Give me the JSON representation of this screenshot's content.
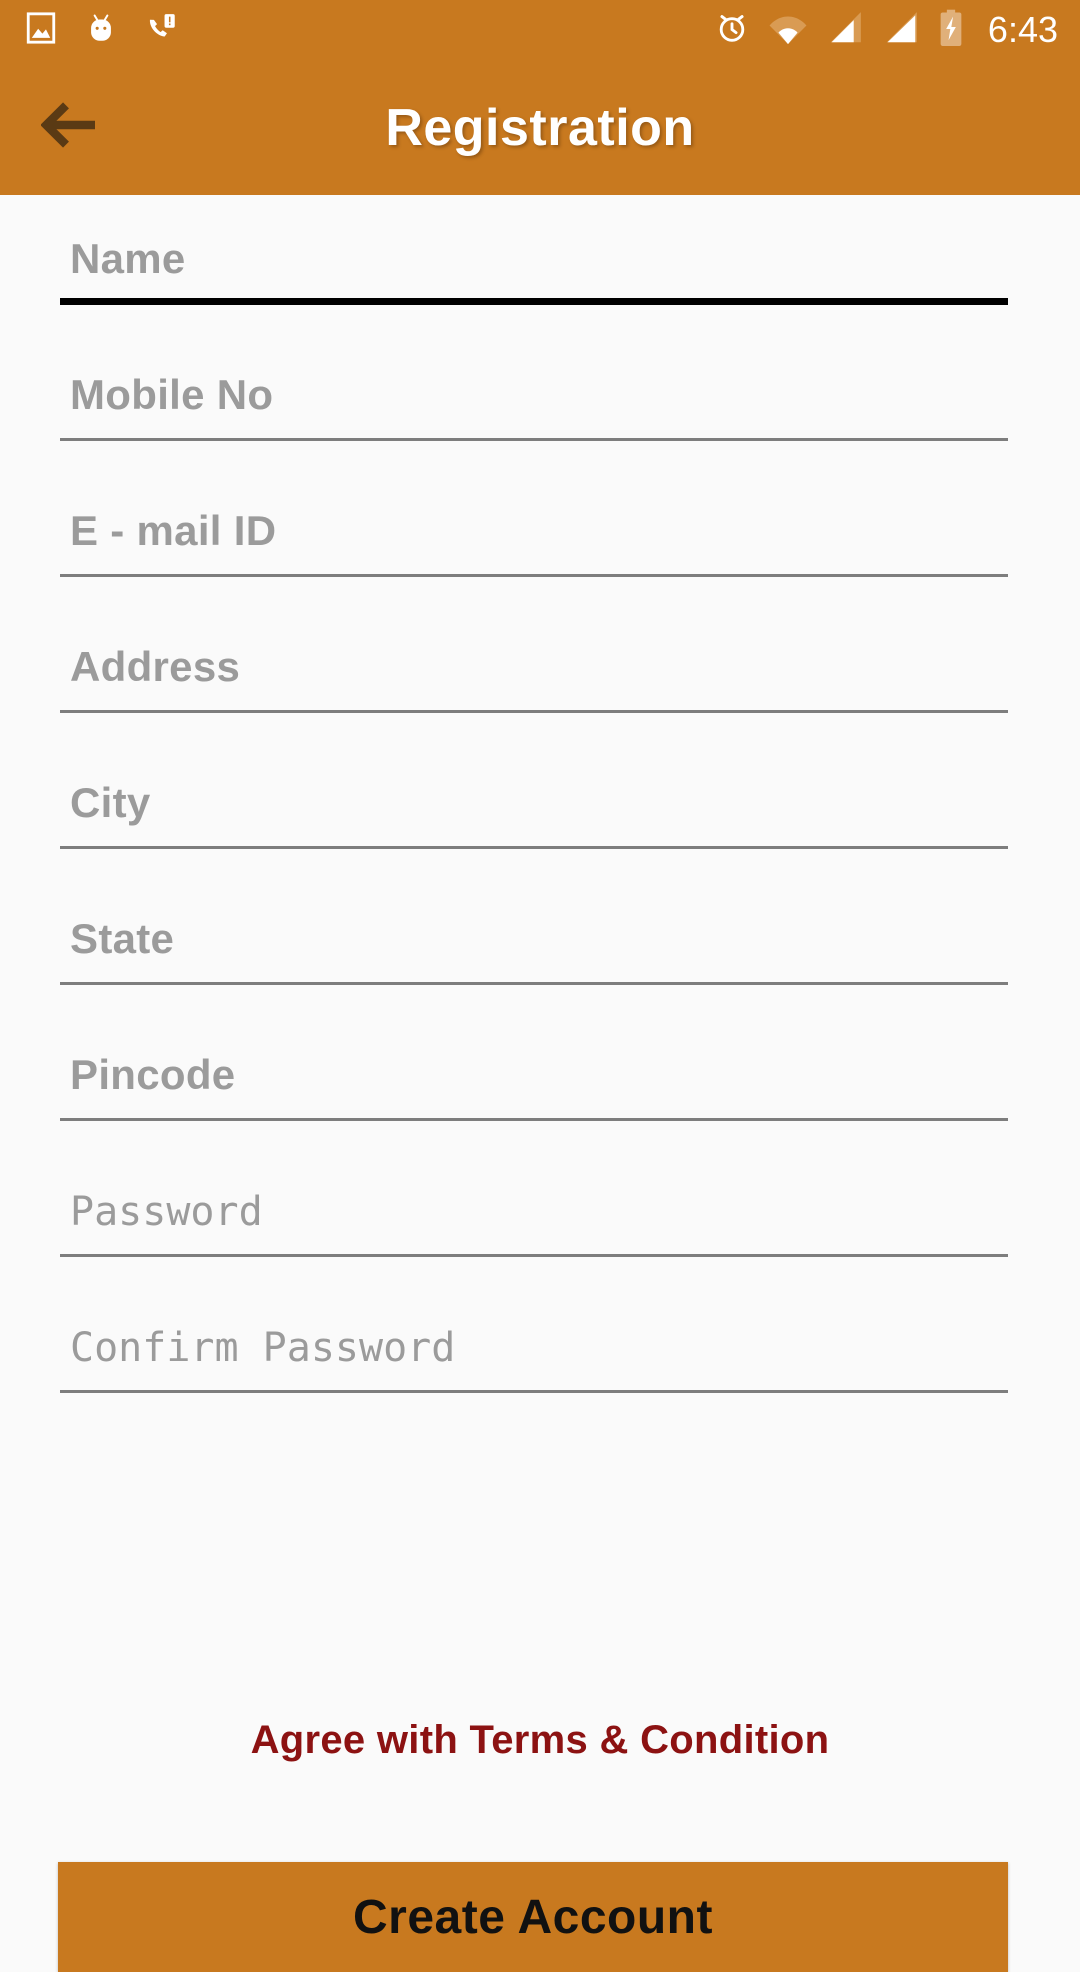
{
  "statusbar": {
    "time": "6:43",
    "left_icons": [
      {
        "name": "screenshot-image-icon"
      },
      {
        "name": "android-system-icon"
      },
      {
        "name": "missed-call-icon"
      }
    ],
    "right_icons": [
      {
        "name": "alarm-clock-icon"
      },
      {
        "name": "wifi-icon"
      },
      {
        "name": "cellular-signal-sim1-icon"
      },
      {
        "name": "cellular-signal-sim2-icon"
      },
      {
        "name": "battery-charging-icon"
      }
    ],
    "background_color": "#C8791F",
    "foreground_color": "#FFFFFF"
  },
  "appbar": {
    "title": "Registration",
    "back_label": "Back",
    "background_color": "#C8791F",
    "title_color": "#FFFFFF",
    "back_arrow_color": "#5A3A14"
  },
  "form": {
    "fields": [
      {
        "name": "name",
        "placeholder": "Name",
        "value": "",
        "focused": true,
        "mono": false
      },
      {
        "name": "mobile-no",
        "placeholder": "Mobile No",
        "value": "",
        "focused": false,
        "mono": false
      },
      {
        "name": "email-id",
        "placeholder": "E - mail ID",
        "value": "",
        "focused": false,
        "mono": false
      },
      {
        "name": "address",
        "placeholder": "Address",
        "value": "",
        "focused": false,
        "mono": false
      },
      {
        "name": "city",
        "placeholder": "City",
        "value": "",
        "focused": false,
        "mono": false
      },
      {
        "name": "state",
        "placeholder": "State",
        "value": "",
        "focused": false,
        "mono": false
      },
      {
        "name": "pincode",
        "placeholder": "Pincode",
        "value": "",
        "focused": false,
        "mono": false
      },
      {
        "name": "password",
        "placeholder": "Password",
        "value": "",
        "focused": false,
        "mono": true
      },
      {
        "name": "confirm-password",
        "placeholder": "Confirm Password",
        "value": "",
        "focused": false,
        "mono": true
      }
    ],
    "placeholder_color": "#9B9B9B",
    "rule_color": "#7D7D7D",
    "focused_rule_color": "#000000",
    "background_color": "#FAFAFA"
  },
  "terms": {
    "label": "Agree with Terms & Condition",
    "color": "#8C1212"
  },
  "cta": {
    "label": "Create Account",
    "background_color": "#C8791F",
    "text_color": "#111111"
  }
}
